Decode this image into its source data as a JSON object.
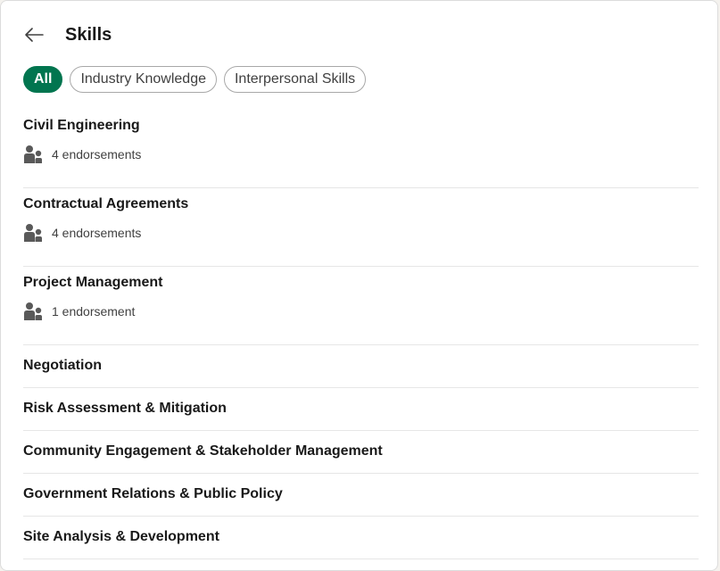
{
  "header": {
    "title": "Skills",
    "back_icon": "arrow-left-icon"
  },
  "filters": [
    {
      "label": "All",
      "active": true
    },
    {
      "label": "Industry Knowledge",
      "active": false
    },
    {
      "label": "Interpersonal Skills",
      "active": false
    }
  ],
  "skills": [
    {
      "name": "Civil Engineering",
      "endorsements": "4 endorsements"
    },
    {
      "name": "Contractual Agreements",
      "endorsements": "4 endorsements"
    },
    {
      "name": "Project Management",
      "endorsements": "1 endorsement"
    },
    {
      "name": "Negotiation"
    },
    {
      "name": "Risk Assessment & Mitigation"
    },
    {
      "name": "Community Engagement & Stakeholder Management"
    },
    {
      "name": "Government Relations & Public Policy"
    },
    {
      "name": "Site Analysis & Development"
    }
  ],
  "colors": {
    "accent": "#01754f",
    "text": "#191919",
    "muted": "#404040"
  },
  "icons": {
    "endorsement": "people-icon"
  }
}
